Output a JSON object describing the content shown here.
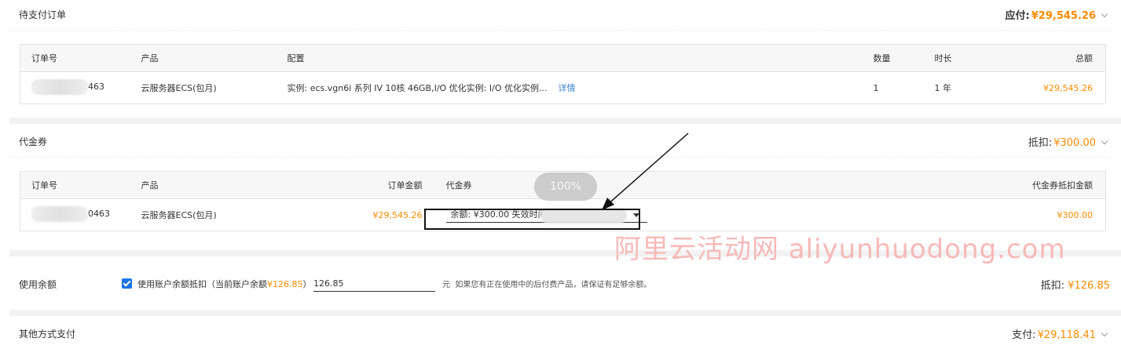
{
  "pending": {
    "title": "待支付订单",
    "payable_label": "应付:",
    "payable_amount": "¥29,545.26",
    "columns": [
      "订单号",
      "产品",
      "配置",
      "数量",
      "时长",
      "总额"
    ],
    "row": {
      "order_suffix": "463",
      "product": "云服务器ECS(包月)",
      "config": "实例: ecs.vgn6i 系列 IV 10核 46GB,I/O 优化实例: I/O 优化实例...",
      "detail_link": "详情",
      "quantity": "1",
      "duration": "1 年",
      "total": "¥29,545.26"
    }
  },
  "voucher": {
    "title": "代金券",
    "deduct_label": "抵扣:",
    "deduct_amount": "¥300.00",
    "columns": [
      "订单号",
      "产品",
      "订单金额",
      "代金券",
      "代金券抵扣金额"
    ],
    "row": {
      "order_suffix": "0463",
      "product": "云服务器ECS(包月)",
      "order_amount": "¥29,545.26",
      "voucher_select": "余额: ¥300.00 失效时间",
      "voucher_deduct": "¥300.00"
    },
    "zoom_badge": "100%"
  },
  "balance": {
    "title": "使用余额",
    "checkbox_checked": true,
    "checkbox_label_prefix": "使用账户余额抵扣（当前账户余额",
    "checkbox_label_amount": "¥126.85",
    "checkbox_label_suffix": "）",
    "input_value": "126.85",
    "unit": "元",
    "hint": "如果您有正在使用中的后付费产品，请保证有足够余额。",
    "deduct_label": "抵扣:",
    "deduct_amount": "¥126.85"
  },
  "other": {
    "title": "其他方式支付",
    "pay_label": "支付:",
    "pay_amount": "¥29,118.41"
  },
  "watermark": "阿里云活动网 aliyunhuodong.com",
  "colors": {
    "accent": "#ff8a00",
    "link": "#3a7fd5",
    "checkbox": "#1a73e8"
  }
}
